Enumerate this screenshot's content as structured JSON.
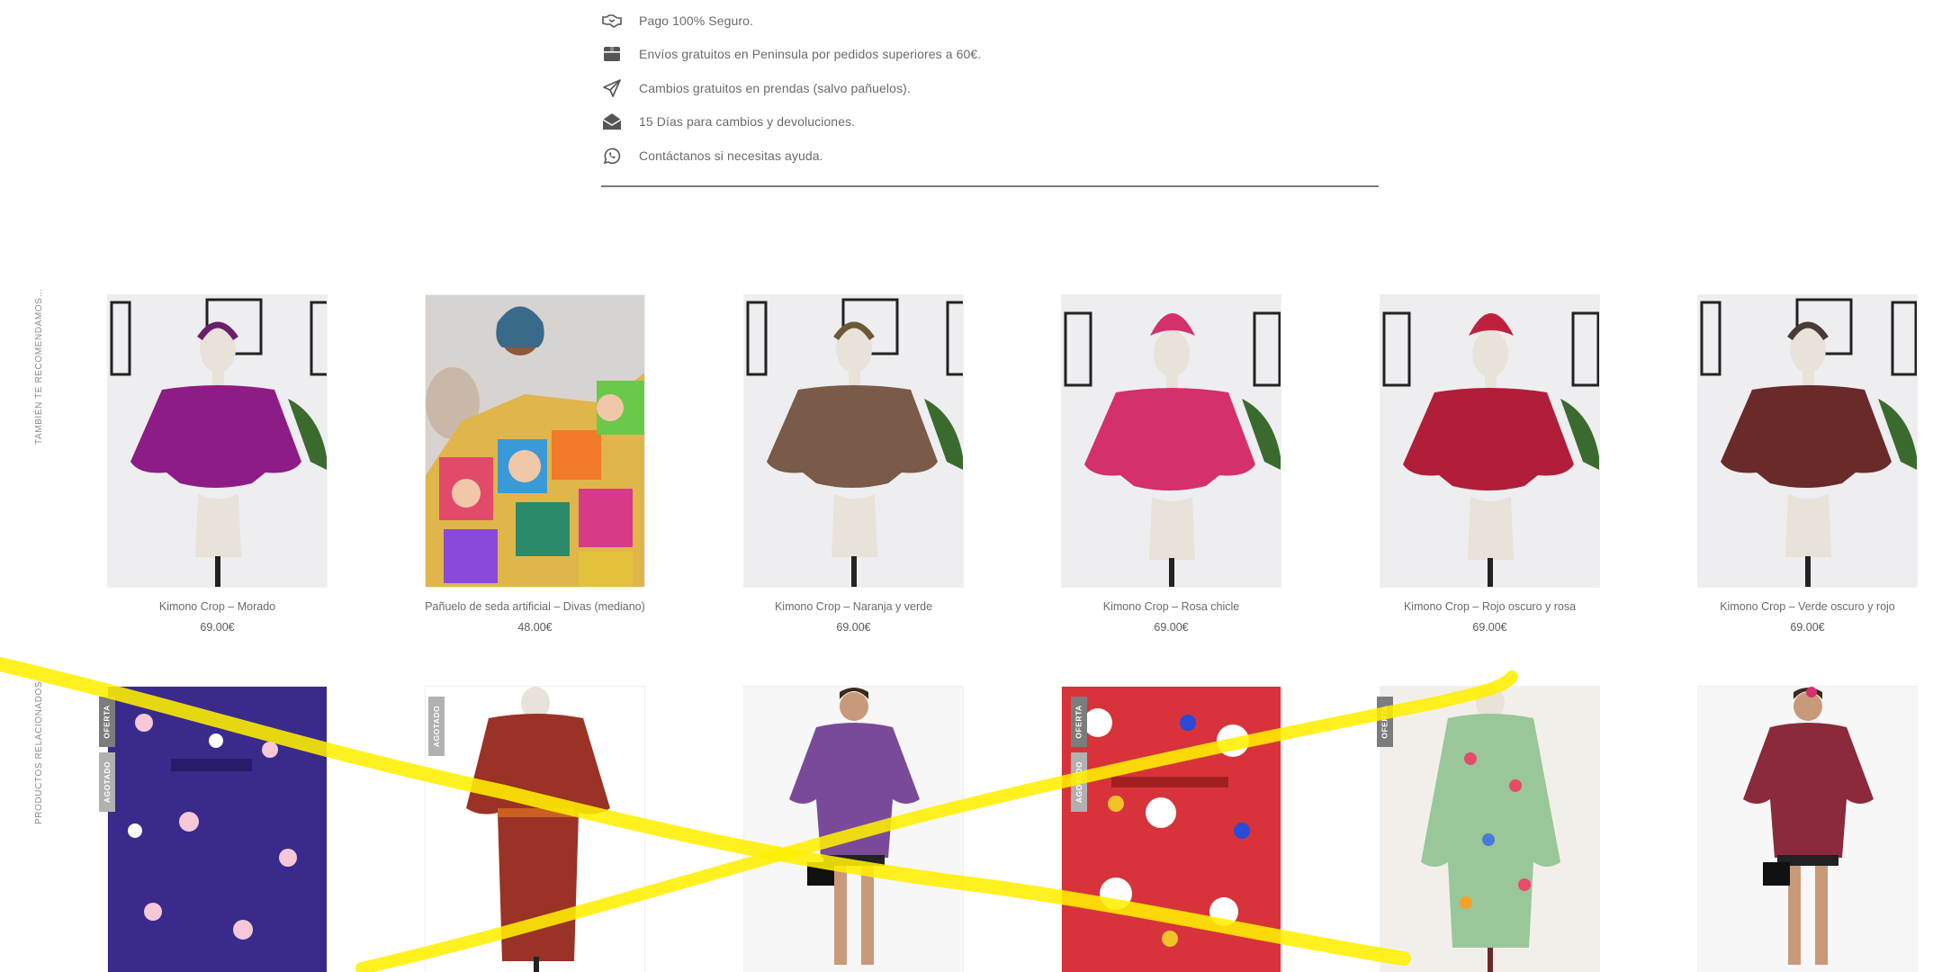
{
  "features": [
    {
      "icon": "handshake-icon",
      "text": "Pago 100% Seguro."
    },
    {
      "icon": "box-icon",
      "text": "Envíos gratuitos en Peninsula por pedidos superiores a 60€."
    },
    {
      "icon": "paper-plane-icon",
      "text": "Cambios gratuitos en prendas (salvo pañuelos)."
    },
    {
      "icon": "envelope-open-icon",
      "text": "15 Días para cambios y devoluciones."
    },
    {
      "icon": "whatsapp-icon",
      "text": "Contáctanos si necesitas ayuda."
    }
  ],
  "sections": {
    "recommended_title": "TAMBIÉN TE RECOMENDAMOS…",
    "related_title": "PRODUCTOS RELACIONADOS"
  },
  "recommended": [
    {
      "name": "Kimono Crop – Morado",
      "price": "69.00€",
      "color": "#8e1c86"
    },
    {
      "name": "Pañuelo de seda artificial – Divas (mediano)",
      "price": "48.00€",
      "color": "#e0b54a"
    },
    {
      "name": "Kimono Crop – Naranja y verde",
      "price": "69.00€",
      "color": "#7a5a48"
    },
    {
      "name": "Kimono Crop – Rosa chicle",
      "price": "69.00€",
      "color": "#d4306a"
    },
    {
      "name": "Kimono Crop – Rojo oscuro y rosa",
      "price": "69.00€",
      "color": "#b01e3a"
    },
    {
      "name": "Kimono Crop – Verde oscuro y rojo",
      "price": "69.00€",
      "color": "#6a2a2a"
    }
  ],
  "related": [
    {
      "color": "#3a2a8c",
      "badges": [
        "OFERTA",
        "AGOTADO"
      ]
    },
    {
      "color": "#9a3226",
      "badges": [
        "AGOTADO"
      ]
    },
    {
      "color": "#7a4a9a",
      "badges": []
    },
    {
      "color": "#d8333a",
      "badges": [
        "OFERTA",
        "AGOTADO"
      ]
    },
    {
      "color": "#9ac79a",
      "badges": [
        "OFERTA"
      ]
    },
    {
      "color": "#8a2a3a",
      "badges": []
    }
  ],
  "colors": {
    "highlighter": "#ffef00",
    "badge_oferta": "#7c7c7c",
    "badge_agotado": "#b1b1b1"
  }
}
